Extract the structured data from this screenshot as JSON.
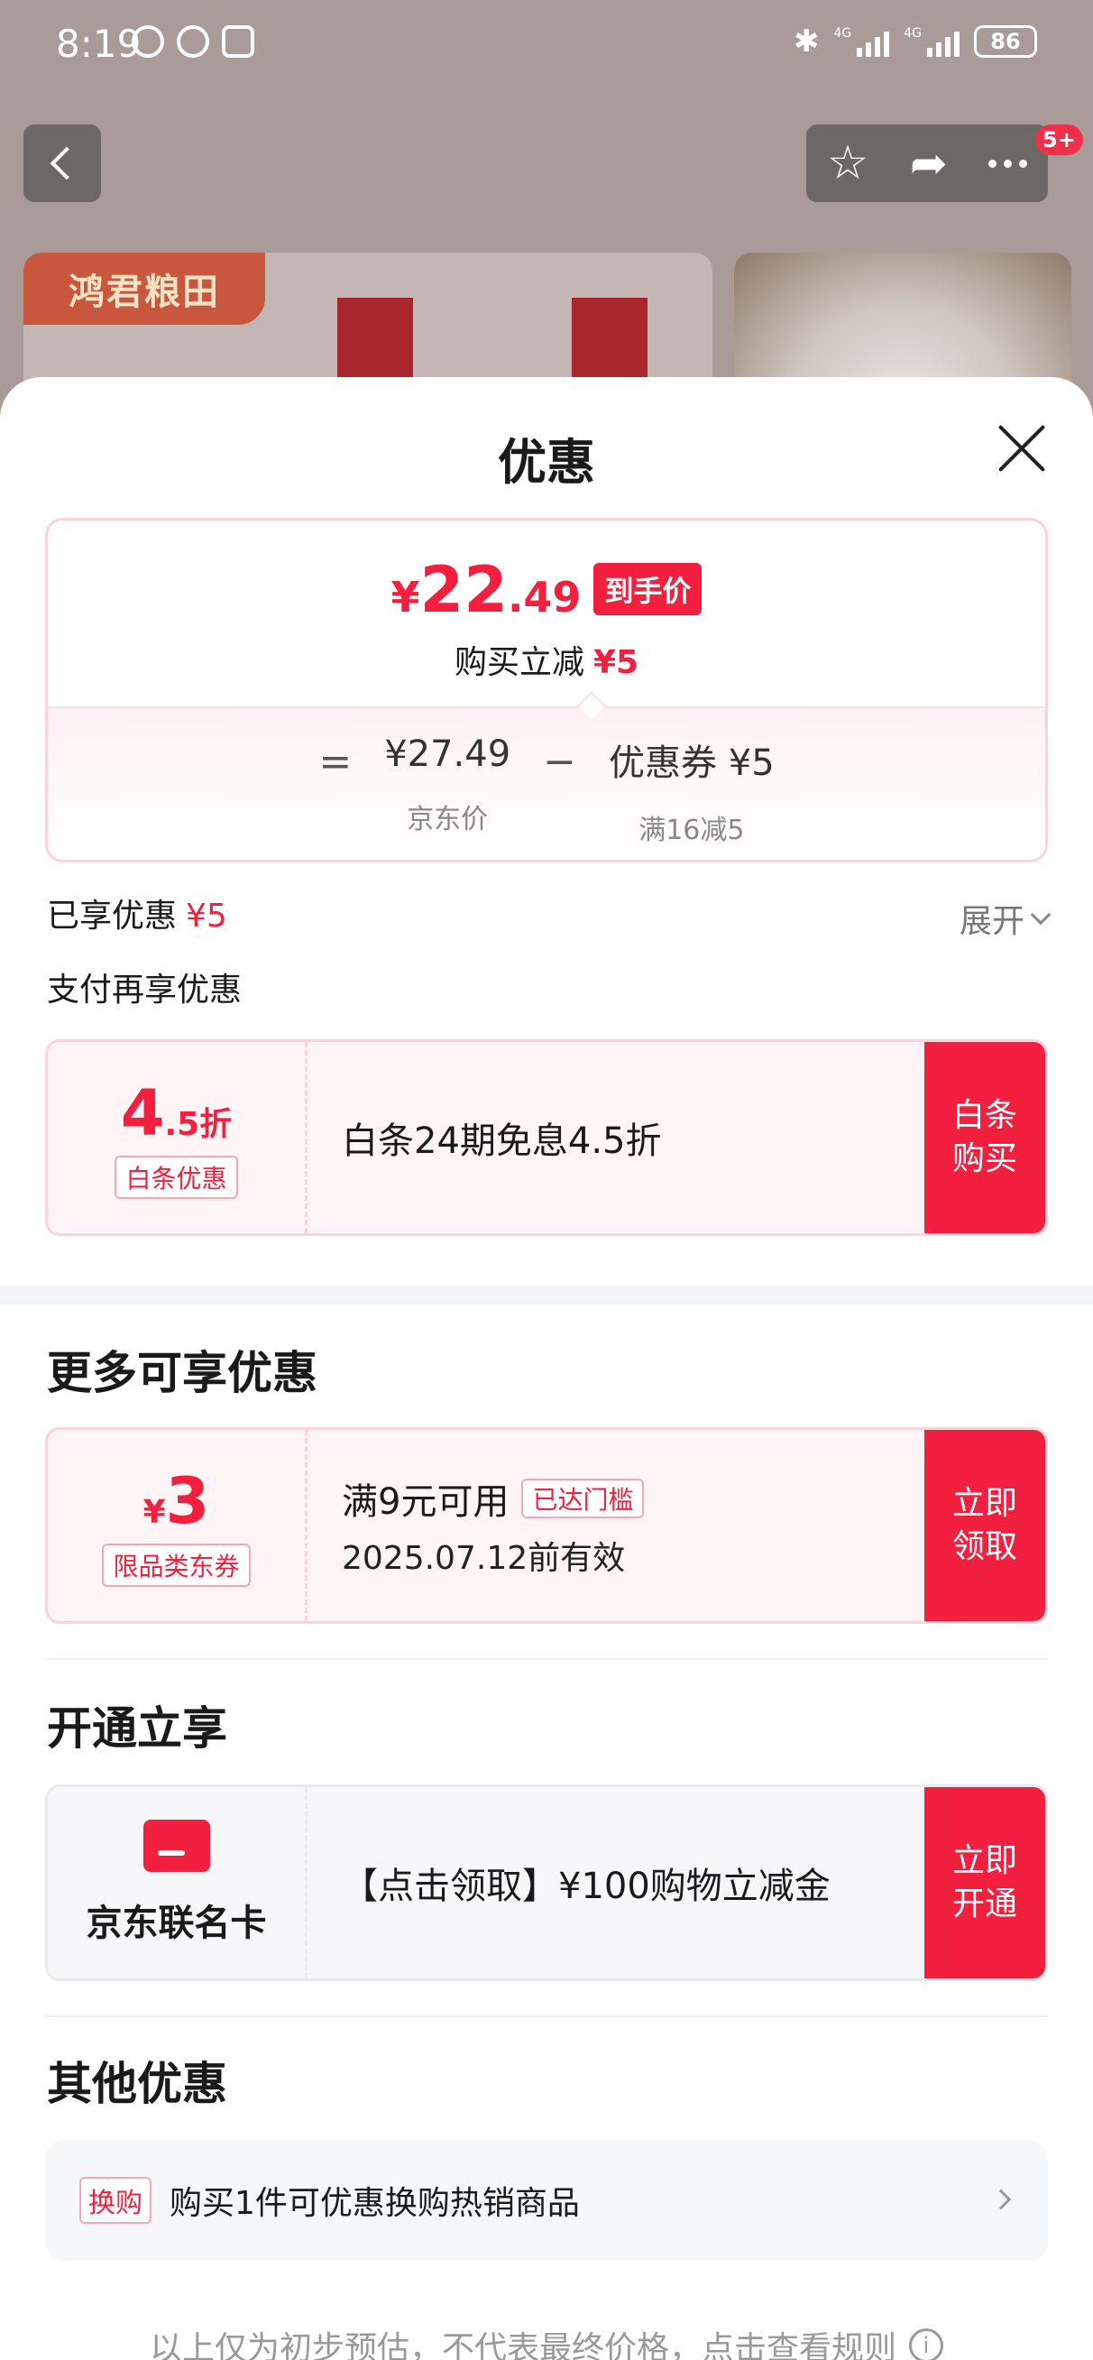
{
  "status": {
    "time": "8:19",
    "battery": "86",
    "network1": "4G",
    "network2": "4G"
  },
  "header": {
    "badge": "5+"
  },
  "product": {
    "brand": "鸿君粮田"
  },
  "sheet": {
    "title": "优惠",
    "price": {
      "currency": "¥",
      "int": "22",
      "dec": ".49",
      "tag": "到手价",
      "reduce_label": "购买立减",
      "reduce_value": "¥5",
      "equals": "=",
      "jd_price": "¥27.49",
      "jd_label": "京东价",
      "minus": "−",
      "coupon_label": "优惠券 ¥5",
      "coupon_sub": "满16减5"
    },
    "enjoyed": {
      "label": "已享优惠",
      "value": "¥5",
      "expand": "展开"
    },
    "pay_more": "支付再享优惠",
    "baitiao": {
      "disc_big": "4",
      "disc_small": ".5折",
      "tag": "白条优惠",
      "title": "白条24期免息4.5折",
      "button": "白条购买"
    },
    "more_title": "更多可享优惠",
    "coupon": {
      "currency": "¥",
      "value": "3",
      "tag": "限品类东券",
      "title": "满9元可用",
      "reach_tag": "已达门槛",
      "valid": "2025.07.12前有效",
      "button": "立即领取"
    },
    "open_title": "开通立享",
    "card": {
      "label": "京东联名卡",
      "title": "【点击领取】¥100购物立减金",
      "button": "立即开通"
    },
    "other_title": "其他优惠",
    "other": {
      "tag": "换购",
      "text": "购买1件可优惠换购热销商品"
    },
    "footnote": "以上仅为初步预估，不代表最终价格，点击查看规则"
  },
  "colors": {
    "accent": "#f2203e",
    "tag_border": "#f5a8b2"
  }
}
